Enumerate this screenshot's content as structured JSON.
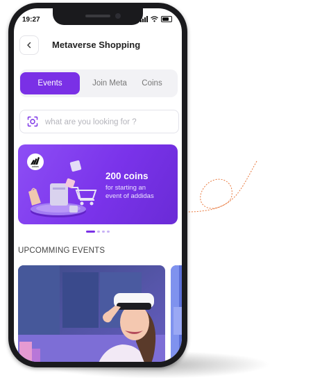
{
  "status_bar": {
    "time": "19:27"
  },
  "header": {
    "back_icon": "chevron-left-icon",
    "title": "Metaverse Shopping"
  },
  "tabs": [
    {
      "label": "Events",
      "active": true
    },
    {
      "label": "Join Meta",
      "active": false
    },
    {
      "label": "Coins",
      "active": false
    }
  ],
  "search": {
    "icon": "scan-icon",
    "placeholder": "what are you looking for ?",
    "value": ""
  },
  "banner": {
    "brand_logo_text": "adidas",
    "headline": "200 coins",
    "line1": "for starting an",
    "line2": "event of addidas"
  },
  "carousel": {
    "pages": 4,
    "active_index": 0
  },
  "upcoming": {
    "title": "UPCOMMING EVENTS"
  },
  "colors": {
    "accent": "#7a30e6",
    "decoration": "#e8763a"
  }
}
